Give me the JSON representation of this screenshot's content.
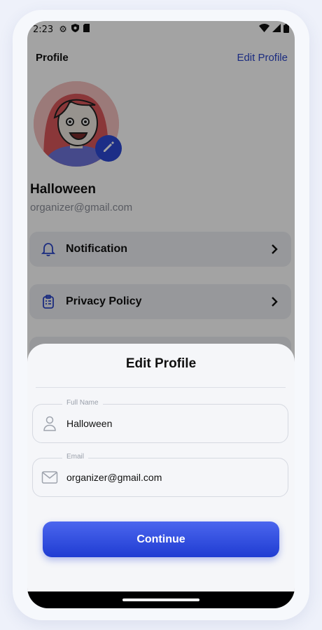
{
  "status_bar": {
    "time": "2:23"
  },
  "header": {
    "title": "Profile",
    "edit_label": "Edit Profile"
  },
  "profile": {
    "name": "Halloween",
    "email": "organizer@gmail.com"
  },
  "menu": [
    {
      "label": "Notification",
      "icon": "bell-icon"
    },
    {
      "label": "Privacy Policy",
      "icon": "clipboard-icon"
    }
  ],
  "sheet": {
    "title": "Edit Profile",
    "fields": [
      {
        "label": "Full Name",
        "value": "Halloween",
        "icon": "user-icon"
      },
      {
        "label": "Email",
        "value": "organizer@gmail.com",
        "icon": "mail-icon"
      }
    ],
    "continue_label": "Continue"
  },
  "colors": {
    "accent": "#2d48d4",
    "link": "#2b45c8",
    "sheet_bg": "#f5f6f9"
  }
}
